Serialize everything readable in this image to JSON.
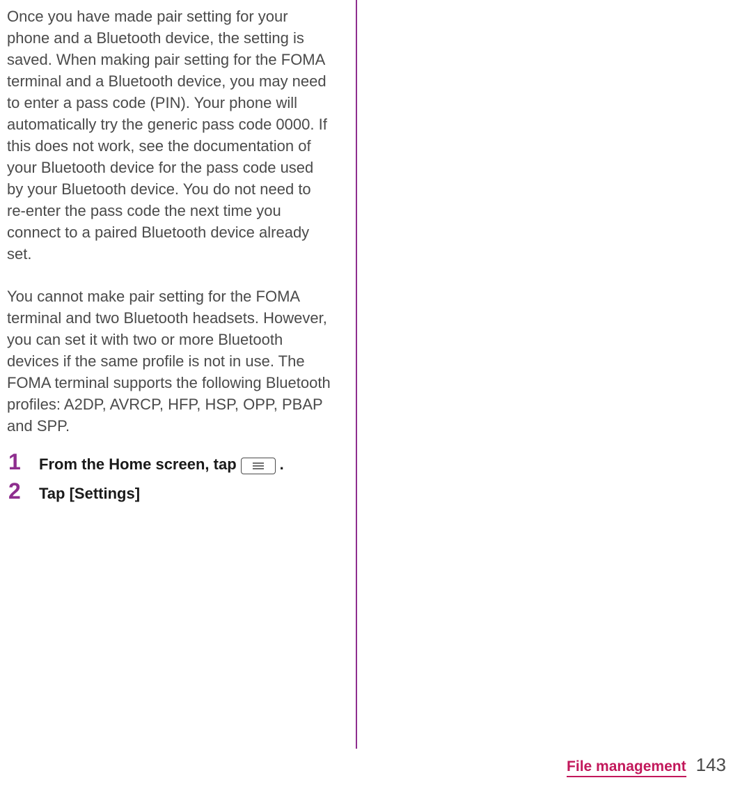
{
  "paragraphs": {
    "p1": "Once you have made pair setting for your phone and a Bluetooth device, the setting is saved. When making pair setting for the FOMA terminal and a Bluetooth device, you may need to enter a pass code (PIN). Your phone will automatically try the generic pass code 0000. If this does not work, see the documentation of your Bluetooth device for the pass code used by your Bluetooth device. You do not need to re-enter the pass code the next time you connect to a paired Bluetooth device already set.",
    "p2": "You cannot make pair setting for  the FOMA terminal and two Bluetooth headsets. However, you can set it with two or more Bluetooth devices if the same profile is not in use. The FOMA terminal supports the following Bluetooth profiles: A2DP, AVRCP, HFP, HSP, OPP, PBAP and SPP."
  },
  "steps": [
    {
      "num": "1",
      "pre": "From the Home screen, tap",
      "icon": "menu-key",
      "post": "."
    },
    {
      "num": "2",
      "pre": "Tap [Settings]",
      "icon": null,
      "post": ""
    }
  ],
  "footer": {
    "section": "File management",
    "page": "143"
  }
}
